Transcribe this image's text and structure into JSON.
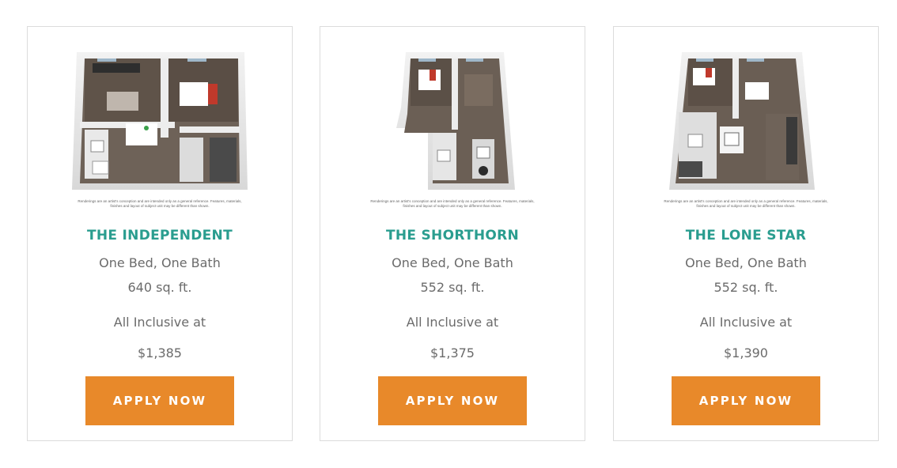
{
  "disclaimer": "Renderings are an artist's conception and are intended only as a general reference. Features, materials, finishes and layout of subject unit may be different than shown.",
  "floorplans": [
    {
      "name": "THE INDEPENDENT",
      "beds": "One Bed, One Bath",
      "sqft": "640 sq. ft.",
      "inclusive": "All Inclusive at",
      "price": "$1,385",
      "button": "APPLY NOW"
    },
    {
      "name": "THE SHORTHORN",
      "beds": "One Bed, One Bath",
      "sqft": "552 sq. ft.",
      "inclusive": "All Inclusive at",
      "price": "$1,375",
      "button": "APPLY NOW"
    },
    {
      "name": "THE LONE STAR",
      "beds": "One Bed, One Bath",
      "sqft": "552 sq. ft.",
      "inclusive": "All Inclusive at",
      "price": "$1,390",
      "button": "APPLY NOW"
    }
  ],
  "colors": {
    "title": "#2a9d8f",
    "button": "#e8892a",
    "text": "#6b6b6b"
  }
}
